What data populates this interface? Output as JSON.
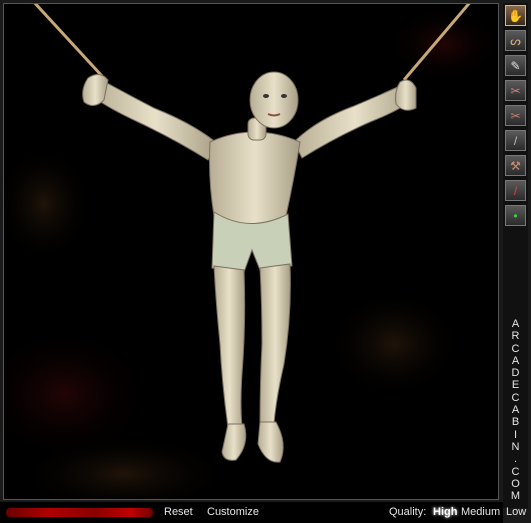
{
  "toolbar": {
    "tools": [
      {
        "icon": "hand-icon",
        "glyph": "✋",
        "active": true
      },
      {
        "icon": "rope-icon",
        "glyph": "ᔕ"
      },
      {
        "icon": "knife-icon",
        "glyph": "✎"
      },
      {
        "icon": "pliers-icon",
        "glyph": "✂"
      },
      {
        "icon": "scissors-icon",
        "glyph": "✂"
      },
      {
        "icon": "nail-icon",
        "glyph": "/"
      },
      {
        "icon": "hammer-icon",
        "glyph": "⚒"
      },
      {
        "icon": "blade-icon",
        "glyph": "/"
      },
      {
        "icon": "syringe-icon",
        "glyph": "•"
      }
    ]
  },
  "sidebar_text": [
    "A",
    "R",
    "C",
    "A",
    "D",
    "E",
    "C",
    "A",
    "B",
    "I",
    "N",
    ".",
    "C",
    "O",
    "M"
  ],
  "bottom_bar": {
    "reset_label": "Reset",
    "customize_label": "Customize",
    "quality_label": "Quality:",
    "quality_options": [
      "High",
      "Medium",
      "Low"
    ],
    "quality_selected": "High"
  },
  "colors": {
    "background": "#000000",
    "blood": "#b00000",
    "skin": "#d8d0b8",
    "shorts": "#c8d0b8",
    "rope": "#c8a878"
  }
}
